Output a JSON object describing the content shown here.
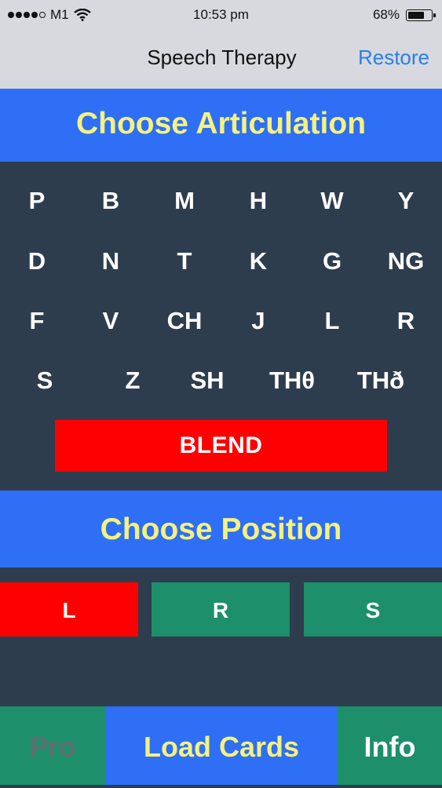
{
  "status_bar": {
    "carrier": "M1",
    "time": "10:53 pm",
    "battery": "68%",
    "battery_level": 0.68
  },
  "nav": {
    "title": "Speech Therapy",
    "restore_label": "Restore"
  },
  "articulation": {
    "header": "Choose Articulation",
    "rows": [
      [
        "P",
        "B",
        "M",
        "H",
        "W",
        "Y"
      ],
      [
        "D",
        "N",
        "T",
        "K",
        "G",
        "NG"
      ],
      [
        "F",
        "V",
        "CH",
        "J",
        "L",
        "R"
      ],
      [
        "S",
        "Z",
        "SH",
        "THθ",
        "THð"
      ]
    ],
    "blend_label": "BLEND"
  },
  "position": {
    "header": "Choose Position",
    "options": [
      "L",
      "R",
      "S"
    ],
    "selected": "L"
  },
  "bottom_bar": {
    "pro_label": "Pro",
    "load_label": "Load Cards",
    "info_label": "Info"
  },
  "colors": {
    "header_blue": "#2e6ff6",
    "header_text_yellow": "#f5f27d",
    "selected_red": "#fe0000",
    "option_green": "#1d8f6b",
    "background_slate": "#2e3d4e",
    "link_blue": "#2a7fe8"
  }
}
